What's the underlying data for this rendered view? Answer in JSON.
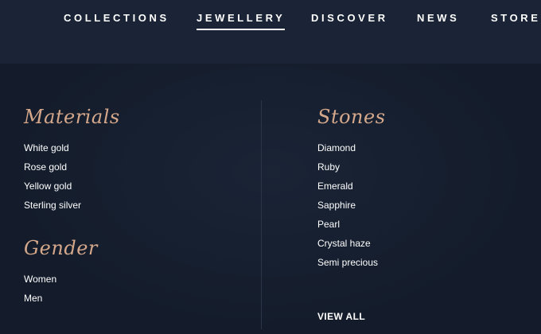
{
  "nav": {
    "items": [
      {
        "label": "COLLECTIONS",
        "active": false
      },
      {
        "label": "JEWELLERY",
        "active": true
      },
      {
        "label": "DISCOVER",
        "active": false
      },
      {
        "label": "NEWS",
        "active": false
      },
      {
        "label": "STORE",
        "active": false
      }
    ]
  },
  "menu": {
    "materials": {
      "title": "Materials",
      "items": [
        "White gold",
        "Rose gold",
        "Yellow gold",
        "Sterling silver"
      ]
    },
    "gender": {
      "title": "Gender",
      "items": [
        "Women",
        "Men"
      ]
    },
    "stones": {
      "title": "Stones",
      "items": [
        "Diamond",
        "Ruby",
        "Emerald",
        "Sapphire",
        "Pearl",
        "Crystal haze",
        "Semi precious"
      ]
    },
    "view_all": "VIEW ALL"
  },
  "colors": {
    "background": "#141c2b",
    "topbar": "#1a2436",
    "heading_accent": "#d5a88b",
    "text": "#ffffff",
    "divider": "#2c3547"
  }
}
